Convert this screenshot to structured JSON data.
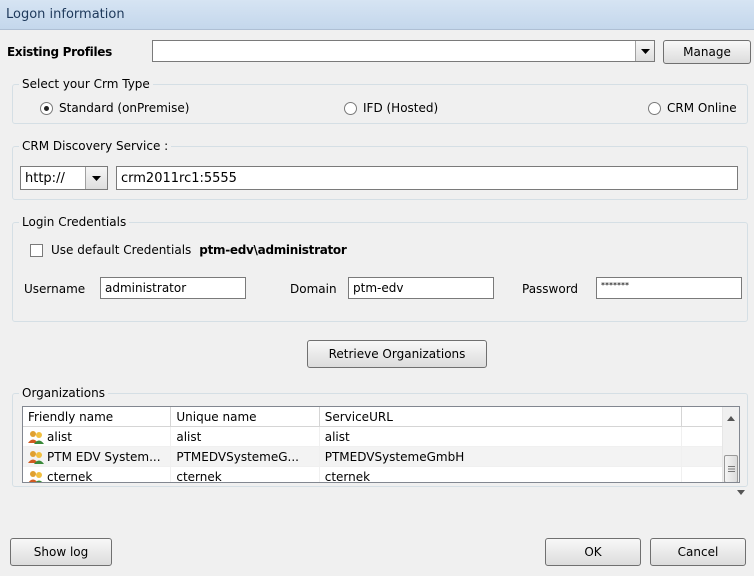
{
  "window": {
    "title": "Logon information"
  },
  "profiles": {
    "label": "Existing Profiles",
    "value": "",
    "manage_label": "Manage"
  },
  "crm_type": {
    "legend": "Select your Crm Type",
    "options": [
      "Standard (onPremise)",
      "IFD (Hosted)",
      "CRM Online"
    ],
    "selected": "Standard (onPremise)"
  },
  "discovery": {
    "legend": "CRM Discovery Service :",
    "protocol": "http://",
    "server": "crm2011rc1:5555"
  },
  "credentials": {
    "legend": "Login Credentials",
    "use_default_label": "Use default Credentials",
    "default_user": "ptm-edv\\administrator",
    "use_default_checked": false,
    "username_label": "Username",
    "username": "administrator",
    "domain_label": "Domain",
    "domain": "ptm-edv",
    "password_label": "Password",
    "password": "*******"
  },
  "retrieve_label": "Retrieve Organizations",
  "organizations": {
    "legend": "Organizations",
    "columns": [
      "Friendly name",
      "Unique name",
      "ServiceURL"
    ],
    "rows": [
      [
        "alist",
        "alist",
        "alist"
      ],
      [
        "PTM EDV System...",
        "PTMEDVSystemeG...",
        "PTMEDVSystemeGmbH"
      ],
      [
        "cternek",
        "cternek",
        "cternek"
      ]
    ]
  },
  "footer": {
    "show_log_label": "Show log",
    "ok_label": "OK",
    "cancel_label": "Cancel"
  }
}
